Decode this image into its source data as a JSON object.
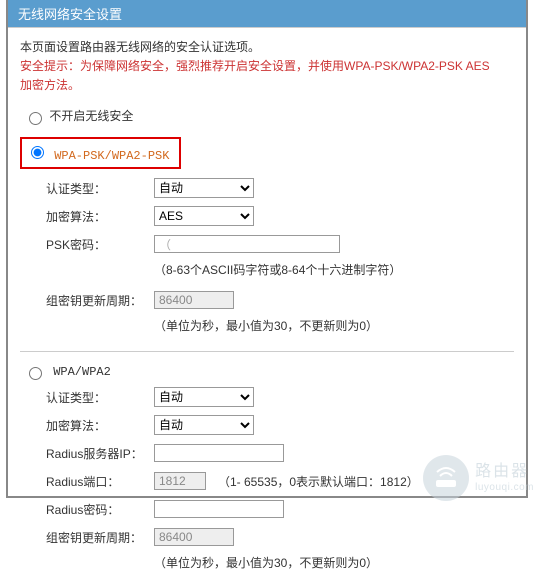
{
  "header": {
    "title": "无线网络安全设置"
  },
  "intro": "本页面设置路由器无线网络的安全认证选项。",
  "warning_l1": "安全提示：为保障网络安全，强烈推荐开启安全设置，并使用WPA-PSK/WPA2-PSK AES",
  "warning_l2": "加密方法。",
  "options": {
    "disable": {
      "label": "不开启无线安全"
    },
    "psk": {
      "label": "WPA-PSK/WPA2-PSK"
    },
    "wpa": {
      "label": "WPA/WPA2"
    }
  },
  "psk_section": {
    "auth_label": "认证类型：",
    "auth_value": "自动",
    "enc_label": "加密算法：",
    "enc_value": "AES",
    "pass_label": "PSK密码：",
    "pass_value": "（",
    "pass_help": "（8-63个ASCII码字符或8-64个十六进制字符）",
    "rekey_label": "组密钥更新周期：",
    "rekey_value": "86400",
    "rekey_help": "（单位为秒，最小值为30，不更新则为0）"
  },
  "wpa_section": {
    "auth_label": "认证类型：",
    "auth_value": "自动",
    "enc_label": "加密算法：",
    "enc_value": "自动",
    "radius_ip_label": "Radius服务器IP：",
    "radius_ip_value": "",
    "radius_port_label": "Radius端口：",
    "radius_port_value": "1812",
    "radius_port_help": "（1- 65535，0表示默认端口：1812）",
    "radius_pass_label": "Radius密码：",
    "radius_pass_value": "",
    "rekey_label": "组密钥更新周期：",
    "rekey_value": "86400",
    "rekey_help": "（单位为秒，最小值为30，不更新则为0）"
  },
  "watermark": {
    "name": "路由器",
    "domain": "luyouqi.com"
  }
}
